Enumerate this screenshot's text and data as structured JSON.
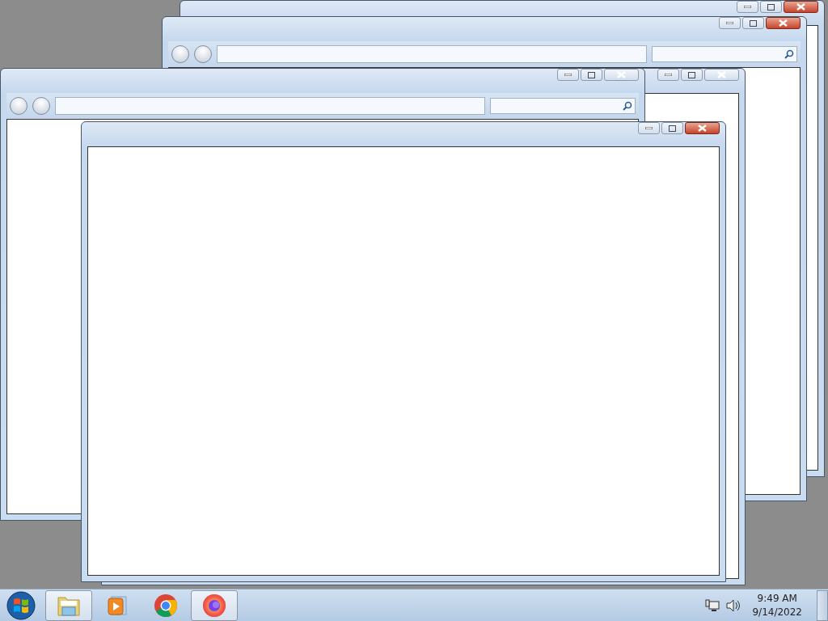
{
  "windows": [
    {
      "kind": "plain",
      "active": true
    },
    {
      "kind": "explorer",
      "active": true
    },
    {
      "kind": "plain",
      "active": false
    },
    {
      "kind": "explorer",
      "active": false
    },
    {
      "kind": "plain",
      "active": true
    }
  ],
  "taskbar": {
    "items": [
      {
        "kind": "explorer",
        "selected": true
      },
      {
        "kind": "media",
        "selected": false
      },
      {
        "kind": "chrome",
        "selected": false
      },
      {
        "kind": "firefox",
        "selected": true
      }
    ],
    "clock": {
      "time": "9:49 AM",
      "date": "9/14/2022"
    }
  }
}
